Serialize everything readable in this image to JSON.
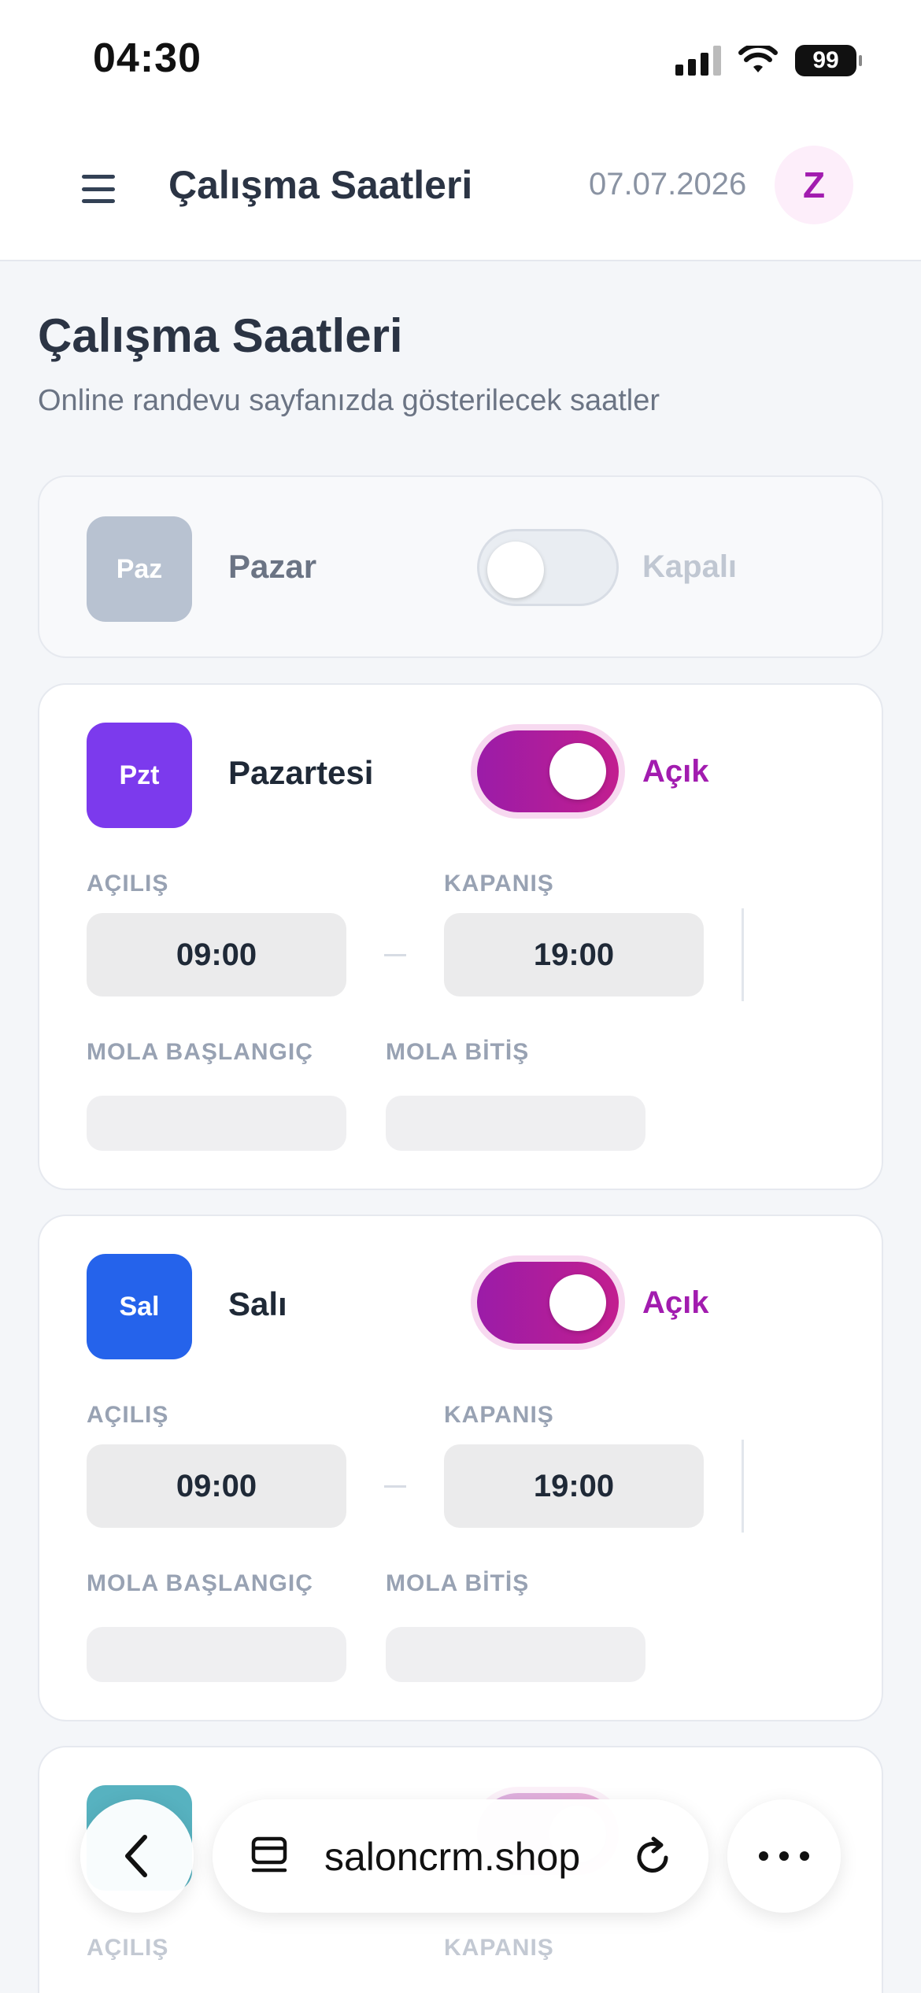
{
  "status_bar": {
    "time": "04:30",
    "battery": "99"
  },
  "top_bar": {
    "title": "Çalışma Saatleri",
    "date": "07.07.2026",
    "avatar_letter": "Z"
  },
  "page": {
    "title": "Çalışma Saatleri",
    "subtitle": "Online randevu sayfanızda gösterilecek saatler"
  },
  "labels": {
    "opening": "AÇILIŞ",
    "closing": "KAPANIŞ",
    "break_start": "MOLA BAŞLANGIÇ",
    "break_end": "MOLA BİTİŞ"
  },
  "days": [
    {
      "abbr": "Paz",
      "name": "Pazar",
      "open": false,
      "status": "Kapalı",
      "badge_color": "#b8c2d1"
    },
    {
      "abbr": "Pzt",
      "name": "Pazartesi",
      "open": true,
      "status": "Açık",
      "opening": "09:00",
      "closing": "19:00",
      "break_start": "",
      "break_end": "",
      "badge_color": "#7c3aed"
    },
    {
      "abbr": "Sal",
      "name": "Salı",
      "open": true,
      "status": "Açık",
      "opening": "09:00",
      "closing": "19:00",
      "break_start": "",
      "break_end": "",
      "badge_color": "#2563eb"
    },
    {
      "badge_color": "#3aa5b5"
    }
  ],
  "browser": {
    "url": "saloncrm.shop"
  },
  "icons": [
    "menu-icon",
    "signal-icon",
    "wifi-icon",
    "battery-icon",
    "back-icon",
    "tabs-icon",
    "reload-icon",
    "more-icon"
  ]
}
